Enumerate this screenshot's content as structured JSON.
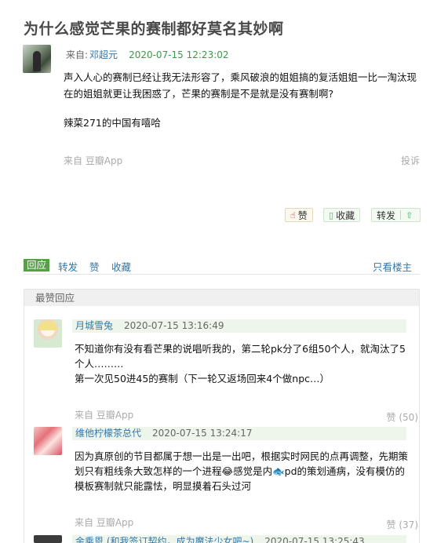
{
  "post": {
    "title": "为什么感觉芒果的赛制都好莫名其妙啊",
    "meta_prefix": "来自:",
    "author": "邓超元",
    "time": "2020-07-15 12:23:02",
    "paragraphs": [
      "声入人心的赛制已经让我无法形容了，乘风破浪的姐姐搞的复活姐姐一比一淘汰现在的姐姐就更让我困惑了，芒果的赛制是不是就是没有赛制啊?",
      "辣菜271的中国有嘻哈"
    ],
    "from": "来自 豆瓣App",
    "report": "投诉"
  },
  "actions": {
    "like": "赞",
    "collect": "收藏",
    "repost": "转发"
  },
  "tabs": {
    "reply": "回应",
    "repost": "转发",
    "like": "赞",
    "collect": "收藏",
    "only_op": "只看楼主"
  },
  "hot": {
    "header": "最赞回应",
    "comments": [
      {
        "name": "月城雪兔",
        "time": "2020-07-15 13:16:49",
        "lines": [
          "不知道你有没有看芒果的说唱听我的，第二轮pk分了6组50个人，就淘汰了5个人………",
          "第一次见50进45的赛制（下一轮又返场回来4个做npc…）"
        ],
        "from": "来自 豆瓣App",
        "likes": "赞 (50)"
      },
      {
        "name": "维他柠檬茶总代",
        "time": "2020-07-15 13:24:17",
        "lines": [
          "因为真原创的节目都属于想一出是一出吧，根据实时网民的点再调整，先期策划只有粗线条大致怎样的一个进程😂感觉是内🐟pd的策划通病，没有模仿的模板赛制就只能露怯，明显摸着石头过河"
        ],
        "from": "来自 豆瓣App",
        "likes": "赞 (37)"
      },
      {
        "name": "金乘恩 (和我签订契约，成为魔法少女吧~)",
        "time": "2020-07-15 13:25:43"
      }
    ]
  }
}
